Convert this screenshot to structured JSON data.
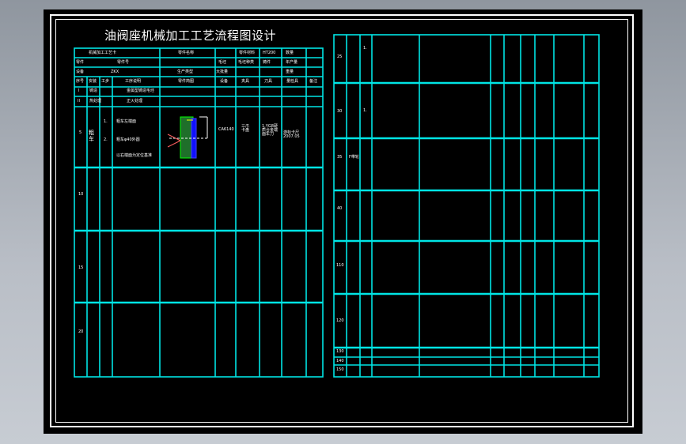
{
  "title": "油阀座机械加工工艺流程图设计",
  "colors": {
    "grid": "#00e5e5",
    "background": "#000000",
    "text": "#ffffff",
    "window_bg": "#a9afb8"
  },
  "left_table": {
    "header_row1": [
      "机械加工工艺卡",
      "零件名称",
      "零件材料",
      "HT200",
      "数量"
    ],
    "header_row2": [
      "零件",
      "零件号",
      "毛坯",
      "毛坯种类",
      "铸件",
      "年产量"
    ],
    "header_row3": [
      "设备",
      "ZKX",
      "生产类型",
      "大批量",
      "重量"
    ],
    "column_headers": [
      "序号",
      "安装",
      "工步",
      "工序说明",
      "零件简图",
      "设备",
      "夹具",
      "刀具",
      "量检具",
      "备注"
    ],
    "rows": [
      {
        "no": "I",
        "install": "铸造",
        "desc": "金属型铸造毛坯"
      },
      {
        "no": "II",
        "install": "热处理",
        "desc": "正火处理"
      }
    ],
    "row5": {
      "no": "5",
      "op": "粗车",
      "steps": [
        "1.",
        "2."
      ],
      "descs": [
        "粗车左端面",
        "粗车φ40外圆",
        "以右端面为定位基准"
      ],
      "machine": "CA6140",
      "fixture": "三爪卡盘",
      "tool": "1.YG8硬质合金端面车刀",
      "gauge": "游标卡尺2007.05"
    },
    "row_numbers": [
      "10",
      "15",
      "20"
    ]
  },
  "right_table": {
    "row_numbers": [
      "25",
      "30",
      "35",
      "40",
      "110",
      "120",
      "130",
      "140",
      "150"
    ],
    "row_notes": [
      "1.",
      "1.",
      "F带轮"
    ]
  }
}
